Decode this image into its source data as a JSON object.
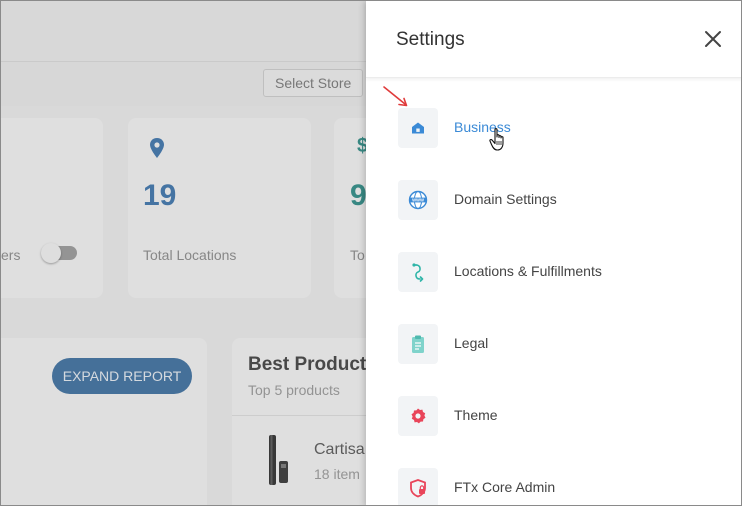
{
  "background": {
    "select_store": "Select Store",
    "cards": {
      "left_partial_label": "ers",
      "locations_value": "19",
      "locations_label": "Total Locations",
      "third_value": "9",
      "third_label": "To",
      "third_symbol": "$"
    },
    "expand_report": "EXPAND REPORT",
    "best_products": {
      "title": "Best Products",
      "subtitle": "Top 5 products",
      "product_name": "Cartisa",
      "product_items": "18 item"
    }
  },
  "settings_panel": {
    "title": "Settings",
    "items": [
      {
        "label": "Business",
        "icon": "home-icon",
        "active": true
      },
      {
        "label": "Domain Settings",
        "icon": "globe-www-icon"
      },
      {
        "label": "Locations & Fulfillments",
        "icon": "route-icon"
      },
      {
        "label": "Legal",
        "icon": "clipboard-icon"
      },
      {
        "label": "Theme",
        "icon": "gear-icon"
      },
      {
        "label": "FTx Core Admin",
        "icon": "shield-lock-icon"
      }
    ]
  },
  "colors": {
    "accent": "#3b8ad6",
    "arrow": "#e03b3b",
    "theme_icon": "#e9455a"
  }
}
